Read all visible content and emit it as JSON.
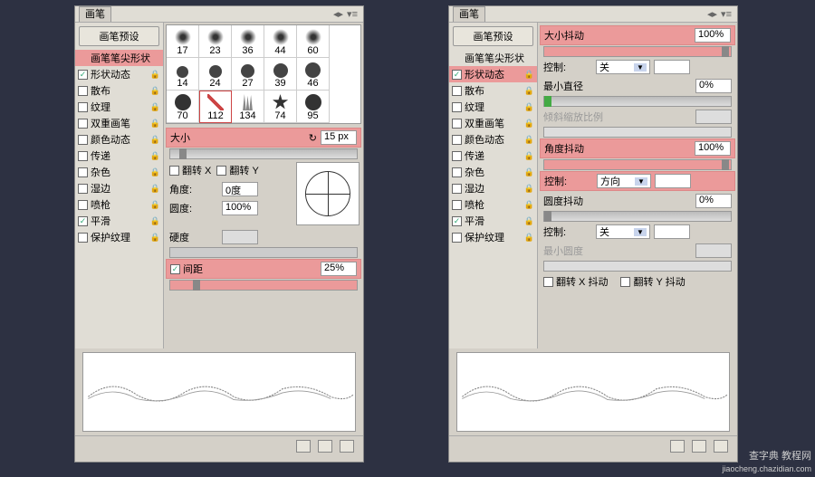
{
  "panel_title": "画笔",
  "preset_button": "画笔预设",
  "sidebar": {
    "items": [
      {
        "label": "画笔笔尖形状",
        "checked": null,
        "highlight": true,
        "lock": false
      },
      {
        "label": "形状动态",
        "checked": true,
        "highlight": false,
        "lock": true
      },
      {
        "label": "散布",
        "checked": false,
        "highlight": false,
        "lock": true
      },
      {
        "label": "纹理",
        "checked": false,
        "highlight": false,
        "lock": true
      },
      {
        "label": "双重画笔",
        "checked": false,
        "highlight": false,
        "lock": true
      },
      {
        "label": "颜色动态",
        "checked": false,
        "highlight": false,
        "lock": true
      },
      {
        "label": "传递",
        "checked": false,
        "highlight": false,
        "lock": true
      },
      {
        "label": "杂色",
        "checked": false,
        "highlight": false,
        "lock": true
      },
      {
        "label": "湿边",
        "checked": false,
        "highlight": false,
        "lock": true
      },
      {
        "label": "喷枪",
        "checked": false,
        "highlight": false,
        "lock": true
      },
      {
        "label": "平滑",
        "checked": true,
        "highlight": false,
        "lock": true
      },
      {
        "label": "保护纹理",
        "checked": false,
        "highlight": false,
        "lock": true
      }
    ],
    "items_right": [
      {
        "label": "画笔笔尖形状",
        "checked": null,
        "highlight": false,
        "lock": false
      },
      {
        "label": "形状动态",
        "checked": true,
        "highlight": true,
        "lock": true
      },
      {
        "label": "散布",
        "checked": false,
        "highlight": false,
        "lock": true
      },
      {
        "label": "纹理",
        "checked": false,
        "highlight": false,
        "lock": true
      },
      {
        "label": "双重画笔",
        "checked": false,
        "highlight": false,
        "lock": true
      },
      {
        "label": "颜色动态",
        "checked": false,
        "highlight": false,
        "lock": true
      },
      {
        "label": "传递",
        "checked": false,
        "highlight": false,
        "lock": true
      },
      {
        "label": "杂色",
        "checked": false,
        "highlight": false,
        "lock": true
      },
      {
        "label": "湿边",
        "checked": false,
        "highlight": false,
        "lock": true
      },
      {
        "label": "喷枪",
        "checked": false,
        "highlight": false,
        "lock": true
      },
      {
        "label": "平滑",
        "checked": true,
        "highlight": false,
        "lock": true
      },
      {
        "label": "保护纹理",
        "checked": false,
        "highlight": false,
        "lock": true
      }
    ]
  },
  "brush_sizes_row1": [
    "17",
    "23",
    "36",
    "44",
    "60"
  ],
  "brush_sizes_row2": [
    "14",
    "24",
    "27",
    "39",
    "46"
  ],
  "brush_sizes_row3": [
    "70",
    "112",
    "134",
    "74",
    "95"
  ],
  "left": {
    "size_label": "大小",
    "size_value": "15 px",
    "flipx": "翻转 X",
    "flipy": "翻转 Y",
    "angle_label": "角度:",
    "angle_value": "0度",
    "roundness_label": "圆度:",
    "roundness_value": "100%",
    "hardness_label": "硬度",
    "spacing_label": "间距",
    "spacing_value": "25%",
    "spacing_checked": true
  },
  "right": {
    "size_jitter_label": "大小抖动",
    "size_jitter_value": "100%",
    "control_label": "控制:",
    "control_value": "关",
    "min_diameter_label": "最小直径",
    "min_diameter_value": "0%",
    "tilt_scale_label": "倾斜缩放比例",
    "angle_jitter_label": "角度抖动",
    "angle_jitter_value": "100%",
    "angle_control_label": "控制:",
    "angle_control_value": "方向",
    "roundness_jitter_label": "圆度抖动",
    "roundness_jitter_value": "0%",
    "round_control_label": "控制:",
    "round_control_value": "关",
    "min_roundness_label": "最小圆度",
    "flipx_jitter": "翻转 X 抖动",
    "flipy_jitter": "翻转 Y 抖动"
  },
  "watermark": {
    "line1": "查字典 教程网",
    "line2": "jiaocheng.chazidian.com"
  }
}
